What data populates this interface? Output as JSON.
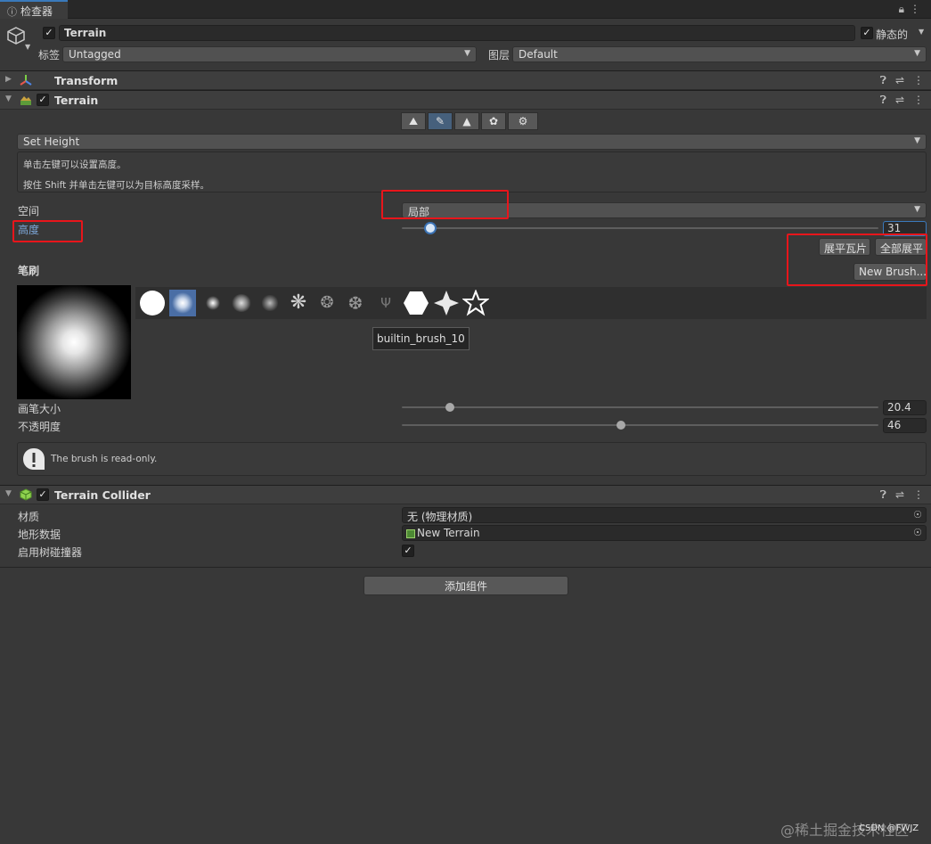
{
  "tab": {
    "title": "检查器",
    "icon": "info-icon"
  },
  "object": {
    "name": "Terrain",
    "enabled": true,
    "static_label": "静态的",
    "static_checked": true
  },
  "tag": {
    "label": "标签",
    "value": "Untagged"
  },
  "layer": {
    "label": "图层",
    "value": "Default"
  },
  "components": {
    "transform": {
      "title": "Transform"
    },
    "terrain": {
      "title": "Terrain",
      "enabled": true
    },
    "collider": {
      "title": "Terrain Collider",
      "enabled": true
    }
  },
  "terrain_tools": [
    "raise-lower-icon",
    "paint-terrain-icon",
    "paint-trees-icon",
    "paint-details-icon",
    "terrain-settings-icon"
  ],
  "paint_mode": {
    "value": "Set Height"
  },
  "help": {
    "line1": "单击左键可以设置高度。",
    "line2": "按住 Shift 并单击左键可以为目标高度采样。"
  },
  "space": {
    "label": "空间",
    "value": "局部"
  },
  "height": {
    "label": "高度",
    "value": "31",
    "fraction": 0.06
  },
  "buttons": {
    "flatten_tile": "展平瓦片",
    "flatten_all": "全部展平",
    "new_brush": "New Brush..."
  },
  "brushes": {
    "label": "笔刷",
    "tooltip": "builtin_brush_10",
    "count": 12,
    "selected_index": 1
  },
  "brush_size": {
    "label": "画笔大小",
    "value": "20.4",
    "fraction": 0.1
  },
  "opacity": {
    "label": "不透明度",
    "value": "46",
    "fraction": 0.46
  },
  "readonly_notice": "The brush is read-only.",
  "collider": {
    "material": {
      "label": "材质",
      "value": "无 (物理材质)"
    },
    "terrain_data": {
      "label": "地形数据",
      "value": "New Terrain"
    },
    "tree_colliders": {
      "label": "启用树碰撞器",
      "checked": true
    }
  },
  "add_component": "添加组件",
  "watermark": "@稀土掘金技术社区",
  "watermark2": "CSDN @FWJZ",
  "colors": {
    "accent": "#3a79bb",
    "highlight_red": "#e8151b",
    "label_blue": "#7da7d9"
  }
}
